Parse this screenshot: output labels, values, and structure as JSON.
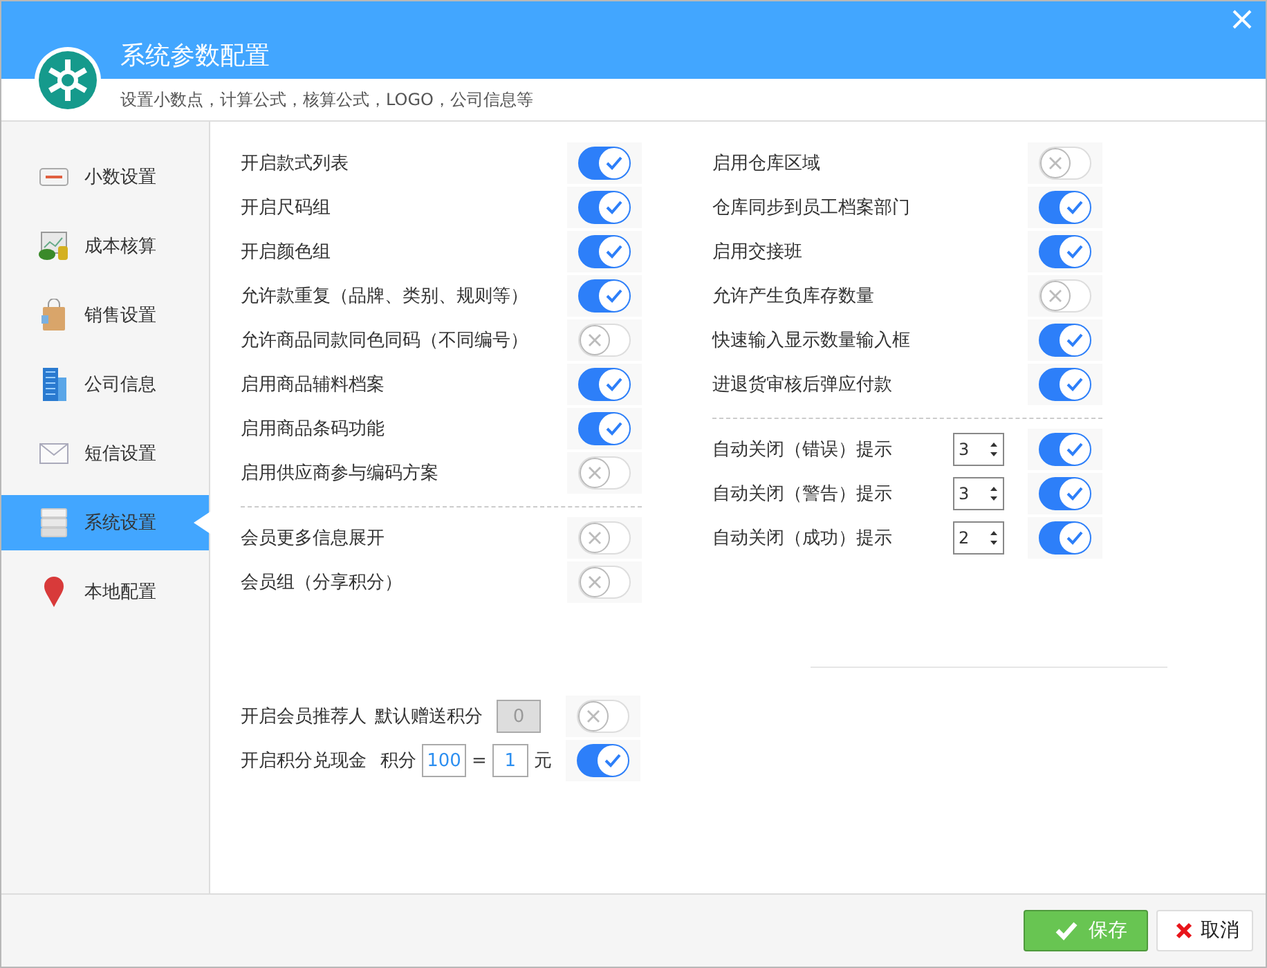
{
  "window": {
    "title": "系统参数配置",
    "subtitle": "设置小数点，计算公式，核算公式，LOGO，公司信息等"
  },
  "sidebar": {
    "items": [
      {
        "label": "小数设置",
        "selected": false
      },
      {
        "label": "成本核算",
        "selected": false
      },
      {
        "label": "销售设置",
        "selected": false
      },
      {
        "label": "公司信息",
        "selected": false
      },
      {
        "label": "短信设置",
        "selected": false
      },
      {
        "label": "系统设置",
        "selected": true
      },
      {
        "label": "本地配置",
        "selected": false
      }
    ]
  },
  "left_groups": [
    {
      "items": [
        {
          "label": "开启款式列表",
          "on": true
        },
        {
          "label": "开启尺码组",
          "on": true
        },
        {
          "label": "开启颜色组",
          "on": true
        },
        {
          "label": "允许款重复（品牌、类别、规则等）",
          "on": true
        },
        {
          "label": "允许商品同款同色同码（不同编号）",
          "on": false
        },
        {
          "label": "启用商品辅料档案",
          "on": true
        },
        {
          "label": "启用商品条码功能",
          "on": true
        },
        {
          "label": "启用供应商参与编码方案",
          "on": false
        }
      ]
    },
    {
      "items": [
        {
          "label": "会员更多信息展开",
          "on": false
        },
        {
          "label": "会员组（分享积分）",
          "on": false
        }
      ]
    }
  ],
  "right_groups": [
    {
      "items": [
        {
          "kind": "toggle",
          "label": "启用仓库区域",
          "on": false
        },
        {
          "kind": "toggle",
          "label": "仓库同步到员工档案部门",
          "on": true
        },
        {
          "kind": "toggle",
          "label": "启用交接班",
          "on": true
        },
        {
          "kind": "toggle",
          "label": "允许产生负库存数量",
          "on": false
        },
        {
          "kind": "toggle",
          "label": "快速输入显示数量输入框",
          "on": true
        },
        {
          "kind": "toggle",
          "label": "进退货审核后弹应付款",
          "on": true
        }
      ]
    },
    {
      "items": [
        {
          "kind": "spinner",
          "label": "自动关闭（错误）提示",
          "value": "3",
          "on": true
        },
        {
          "kind": "spinner",
          "label": "自动关闭（警告）提示",
          "value": "3",
          "on": true
        },
        {
          "kind": "spinner",
          "label": "自动关闭（成功）提示",
          "value": "2",
          "on": true
        }
      ]
    }
  ],
  "referrer": {
    "label": "开启会员推荐人",
    "field_label": "默认赠送积分",
    "field_value": "0",
    "field_disabled": true,
    "on": false
  },
  "points": {
    "label": "开启积分兑现金",
    "points_label": "积分",
    "points_value": "100",
    "equals": "=",
    "cash_value": "1",
    "unit": "元",
    "on": true
  },
  "footer": {
    "buttons": [
      {
        "kind": "save",
        "label": "保存"
      },
      {
        "kind": "cancel",
        "label": "取消"
      }
    ]
  }
}
